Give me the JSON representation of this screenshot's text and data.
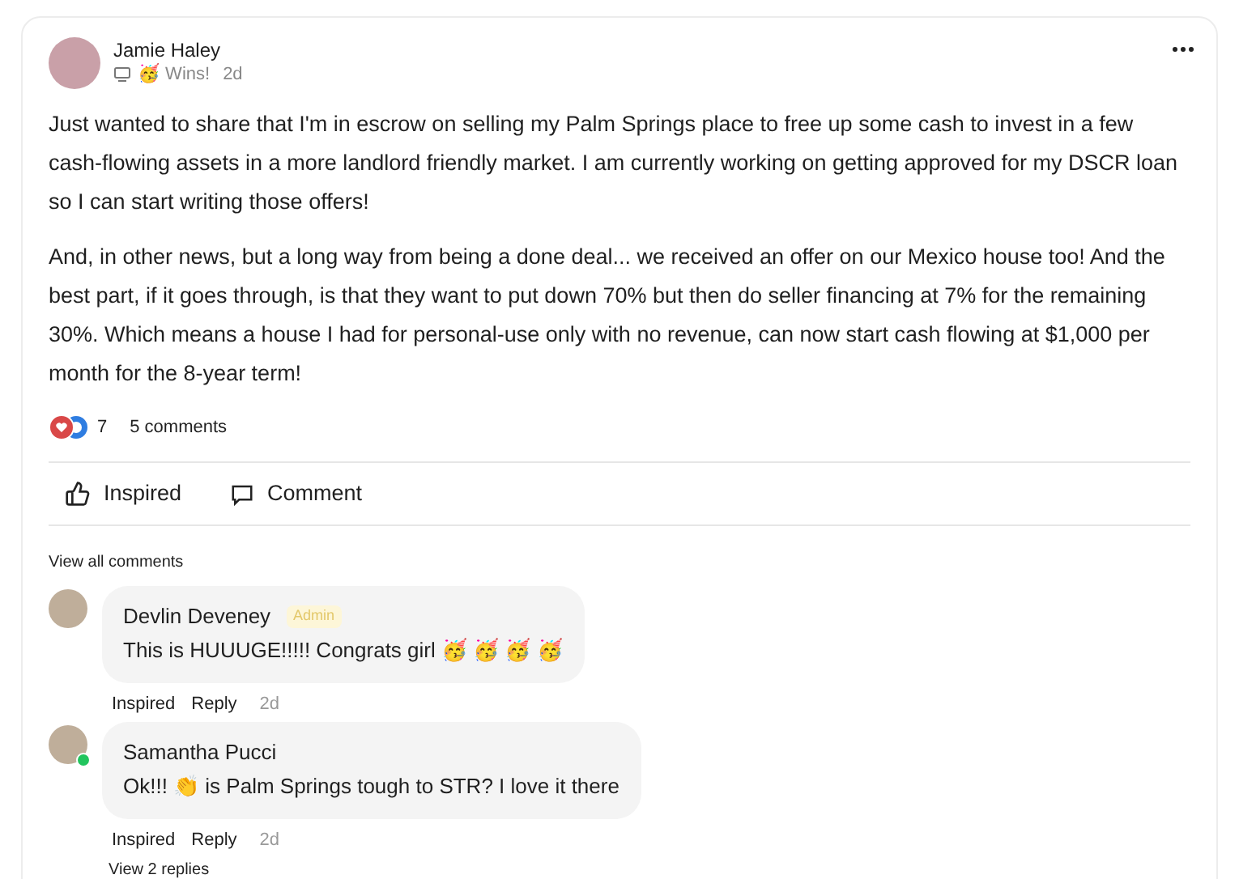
{
  "post": {
    "author": "Jamie Haley",
    "category": "🥳 Wins!",
    "time": "2d",
    "paragraphs": [
      "Just wanted to share that I'm in escrow on selling my Palm Springs place to free up some cash to invest in a few cash-flowing assets in a more landlord friendly market. I am currently working on getting approved for my DSCR loan so I can start writing those offers!",
      "And, in other news, but a long way from being a done deal... we received an offer on our Mexico house too! And the best part, if it goes through, is that they want to put down 70% but then do seller financing at 7% for the remaining 30%. Which means a house I had for personal-use only with no revenue, can now start cash flowing at $1,000 per month for the 8-year term!"
    ],
    "reaction_count": "7",
    "comment_count": "5 comments"
  },
  "actions": [
    "Inspired",
    "Comment"
  ],
  "view_all": "View all comments",
  "comments": [
    {
      "author": "Devlin Deveney",
      "badge": "Admin",
      "text": "This is HUUUGE!!!!! Congrats girl 🥳 🥳 🥳 🥳",
      "online": false,
      "actions": [
        "Inspired",
        "Reply"
      ],
      "time": "2d"
    },
    {
      "author": "Samantha Pucci",
      "text": "Ok!!! 👏 is Palm Springs tough to STR? I love it there",
      "online": true,
      "actions": [
        "Inspired",
        "Reply"
      ],
      "time": "2d",
      "replies": "View 2 replies"
    }
  ]
}
